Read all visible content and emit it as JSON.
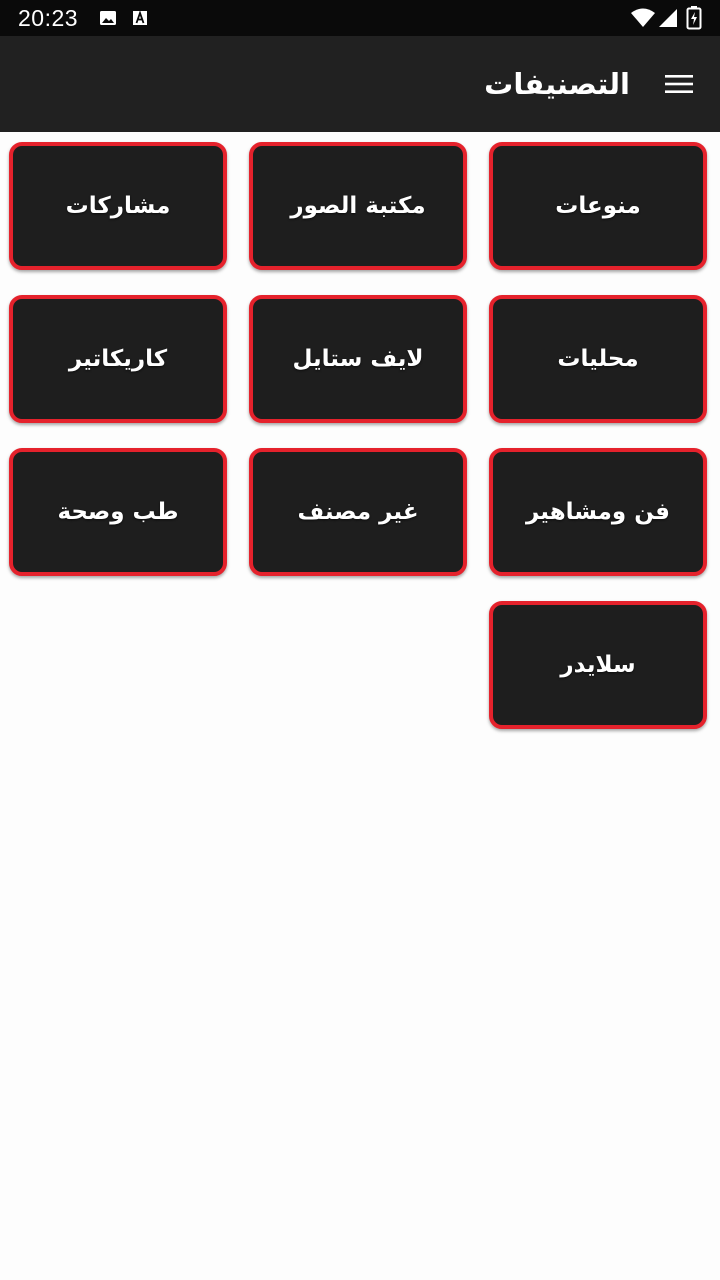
{
  "status_bar": {
    "time": "20:23",
    "left_icons": [
      "image-icon",
      "text-a-icon"
    ],
    "right_icons": [
      "wifi-icon",
      "signal-icon",
      "battery-charging-icon"
    ]
  },
  "app_bar": {
    "title": "التصنيفات",
    "menu_icon": "hamburger-menu-icon",
    "background": "#212121"
  },
  "colors": {
    "tile_background": "#1e1e1e",
    "tile_border": "#e5222c",
    "page_background": "#fdfdfd"
  },
  "categories": [
    {
      "label": "منوعات"
    },
    {
      "label": "مكتبة الصور"
    },
    {
      "label": "مشاركات"
    },
    {
      "label": "محليات"
    },
    {
      "label": "لايف ستايل"
    },
    {
      "label": "كاريكاتير"
    },
    {
      "label": "فن ومشاهير"
    },
    {
      "label": "غير مصنف"
    },
    {
      "label": "طب وصحة"
    },
    {
      "label": "سلايدر"
    }
  ]
}
